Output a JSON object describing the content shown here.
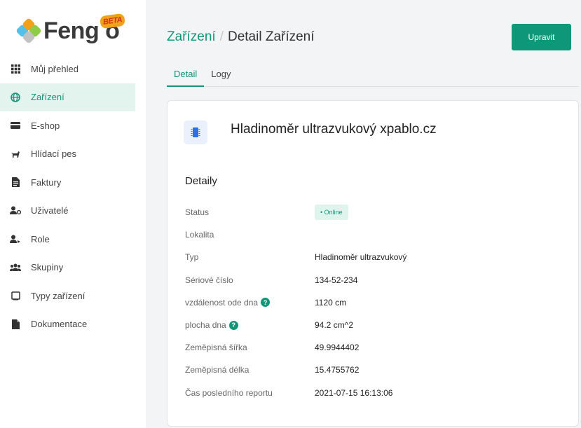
{
  "sidebar": {
    "logo_text": "Feng",
    "beta_label": "BETA",
    "items": [
      {
        "label": "Můj přehled",
        "icon": "grid-icon"
      },
      {
        "label": "Zařízení",
        "icon": "globe-icon",
        "active": true
      },
      {
        "label": "E-shop",
        "icon": "wallet-icon"
      },
      {
        "label": "Hlídací pes",
        "icon": "dog-icon"
      },
      {
        "label": "Faktury",
        "icon": "document-icon"
      },
      {
        "label": "Uživatelé",
        "icon": "user-settings-icon"
      },
      {
        "label": "Role",
        "icon": "user-role-icon"
      },
      {
        "label": "Skupiny",
        "icon": "users-group-icon"
      },
      {
        "label": "Typy zařízení",
        "icon": "square-icon"
      },
      {
        "label": "Dokumentace",
        "icon": "file-icon"
      }
    ]
  },
  "header": {
    "breadcrumb_link": "Zařízení",
    "breadcrumb_sep": "/",
    "breadcrumb_current": "Detail Zařízení",
    "edit_button": "Upravit"
  },
  "tabs": [
    {
      "label": "Detail",
      "active": true
    },
    {
      "label": "Logy"
    }
  ],
  "device": {
    "title": "Hladinoměr ultrazvukový xpablo.cz",
    "icon": "chip-icon",
    "section_title": "Detaily",
    "status_label": "Status",
    "status_value": "• Online",
    "details": [
      {
        "label": "Lokalita",
        "value": ""
      },
      {
        "label": "Typ",
        "value": "Hladinoměr ultrazvukový"
      },
      {
        "label": "Sériové číslo",
        "value": "134-52-234"
      },
      {
        "label": "vzdálenost ode dna",
        "value": "1120 cm",
        "help": true
      },
      {
        "label": "plocha dna",
        "value": "94.2 cm^2",
        "help": true
      },
      {
        "label": "Zeměpisná šířka",
        "value": "49.9944402"
      },
      {
        "label": "Zeměpisná délka",
        "value": "15.4755762"
      },
      {
        "label": "Čas posledního reportu",
        "value": "2021-07-15 16:13:06"
      }
    ]
  },
  "colors": {
    "accent": "#0f977a",
    "active_bg": "#e3f4ef"
  }
}
